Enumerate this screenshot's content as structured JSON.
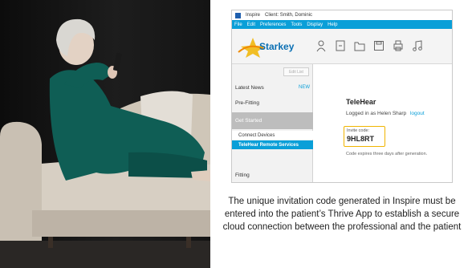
{
  "photo": {
    "alt": "Woman on couch using phone"
  },
  "window": {
    "app_name": "Inspire",
    "client_label": "Client: Smith, Dominic"
  },
  "menu": [
    "File",
    "Edit",
    "Preferences",
    "Tools",
    "Display",
    "Help"
  ],
  "toolbar": {
    "logo_text": "Starkey",
    "icons": [
      "person-icon",
      "new-document-icon",
      "folder-icon",
      "save-icon",
      "printer-icon",
      "music-note-icon"
    ]
  },
  "sidebar": {
    "edit_list": "Edit List",
    "items": [
      {
        "label": "Latest News",
        "badge": "NEW"
      },
      {
        "label": "Pre-Fitting"
      },
      {
        "label": "Get Started"
      },
      {
        "label": "Connect Devices"
      },
      {
        "label": "TeleHear Remote Services"
      },
      {
        "label": "Fitting"
      }
    ]
  },
  "main": {
    "heading": "TeleHear",
    "logged_in": "Logged in as Helen Sharp",
    "logout": "logout",
    "invite_label": "Invite code:",
    "invite_code": "9HL8RT",
    "expiry_note": "Code expires three days after generation."
  },
  "caption": "The unique invitation code generated in Inspire must be entered into the patient’s Thrive App to establish a secure cloud connection between the professional and the patient",
  "colors": {
    "accent": "#0a9fd8",
    "highlight": "#f0b400",
    "brand": "#0a6fb3"
  }
}
